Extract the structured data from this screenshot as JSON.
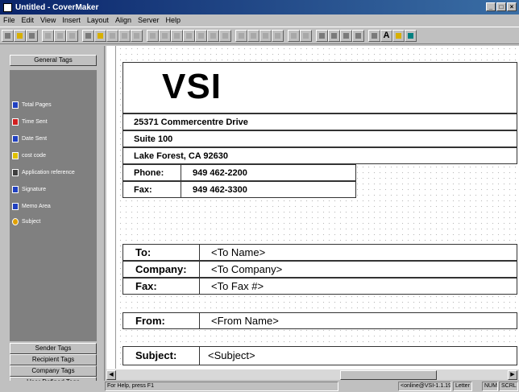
{
  "window": {
    "title": "Untitled - CoverMaker"
  },
  "menu": [
    "File",
    "Edit",
    "View",
    "Insert",
    "Layout",
    "Align",
    "Server",
    "Help"
  ],
  "toolbar": {
    "text_tool": "A"
  },
  "left_panel": {
    "general_tags": "General Tags",
    "tags": [
      "Total Pages",
      "Time Sent",
      "Date Sent",
      "cost code",
      "Application reference",
      "Signature",
      "Memo Area",
      "Subject"
    ],
    "sender_tags": "Sender Tags",
    "recipient_tags": "Recipient Tags",
    "company_tags": "Company Tags",
    "user_defined_tags": "User Defined Tags"
  },
  "document": {
    "logo": "VSI",
    "address1": "25371 Commercentre Drive",
    "address2": "Suite 100",
    "address3": "Lake Forest, CA 92630",
    "phone_label": "Phone:",
    "phone_value": "949 462-2200",
    "fax_label": "Fax:",
    "fax_value": "949 462-3300",
    "to_label": "To:",
    "to_value": "<To Name>",
    "company_label": "Company:",
    "company_value": "<To Company>",
    "tofax_label": "Fax:",
    "tofax_value": "<To Fax #>",
    "from_label": "From:",
    "from_value": "<From Name>",
    "subject_label": "Subject:",
    "subject_value": "<Subject>"
  },
  "status": {
    "help": "For Help, press F1",
    "server": "<online@VSI-1.1.19>",
    "paper": "Letter",
    "num": "NUM",
    "scrl": "SCRL"
  },
  "colors": {
    "titlebar": "#0a246a",
    "panel": "#c0c0c0",
    "taglist": "#808080"
  }
}
